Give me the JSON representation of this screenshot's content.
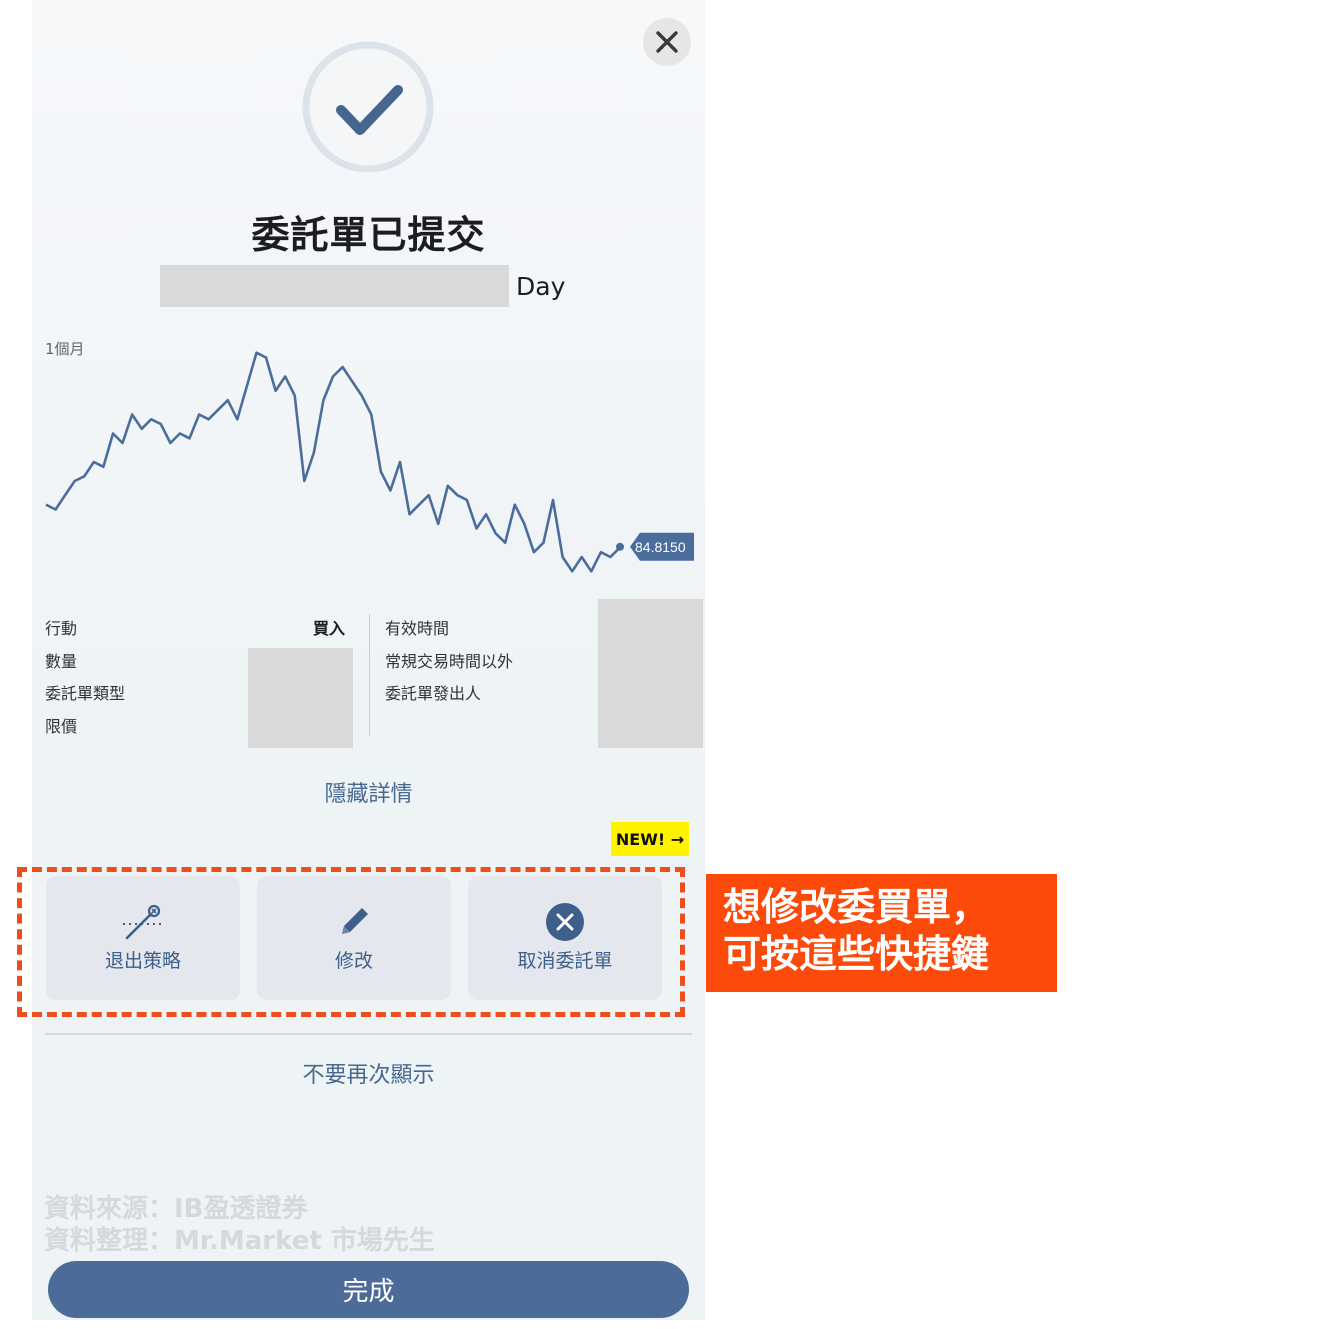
{
  "dialog": {
    "title": "委託單已提交",
    "time_in_force": "Day",
    "period_label": "1個月",
    "last_price_label": "84.8150"
  },
  "details": {
    "left": [
      {
        "label": "行動",
        "value": "買入"
      },
      {
        "label": "數量",
        "value": ""
      },
      {
        "label": "委託單類型",
        "value": ""
      },
      {
        "label": "限價",
        "value": ""
      }
    ],
    "right": [
      {
        "label": "有效時間"
      },
      {
        "label": "常規交易時間以外"
      },
      {
        "label": "委託單發出人"
      }
    ]
  },
  "hide_details_label": "隱藏詳情",
  "new_badge": "NEW! →",
  "actions": [
    {
      "label": "退出策略",
      "icon": "exit-strategy-icon"
    },
    {
      "label": "修改",
      "icon": "pencil-icon"
    },
    {
      "label": "取消委託單",
      "icon": "cancel-circle-icon"
    }
  ],
  "dont_show_again_label": "不要再次顯示",
  "watermark": {
    "line1": "資料來源：IB盈透證券",
    "line2": "資料整理：Mr.Market 市場先生"
  },
  "done_label": "完成",
  "callout": {
    "line1": "想修改委買單，",
    "line2": "可按這些快捷鍵"
  },
  "colors": {
    "accent": "#4c6b98",
    "line": "#4a6d9b",
    "callout": "#fc4a0a",
    "badge": "#fff200"
  },
  "chart_data": {
    "type": "line",
    "title": "",
    "xlabel": "",
    "ylabel": "",
    "grid": false,
    "series": [
      {
        "values": [
          85.7,
          85.6,
          85.9,
          86.2,
          86.3,
          86.6,
          86.5,
          87.2,
          87.0,
          87.6,
          87.3,
          87.5,
          87.4,
          87.0,
          87.2,
          87.1,
          87.6,
          87.5,
          87.7,
          87.9,
          87.5,
          88.2,
          88.9,
          88.8,
          88.1,
          88.4,
          88.0,
          86.2,
          86.8,
          87.9,
          88.4,
          88.6,
          88.3,
          88.0,
          87.6,
          86.4,
          86.0,
          86.6,
          85.5,
          85.7,
          85.9,
          85.3,
          86.1,
          85.9,
          85.8,
          85.2,
          85.5,
          85.1,
          84.9,
          85.7,
          85.3,
          84.7,
          84.9,
          85.8,
          84.6,
          84.3,
          84.6,
          84.3,
          84.7,
          84.6,
          84.8
        ]
      }
    ],
    "last_value": 84.815
  }
}
